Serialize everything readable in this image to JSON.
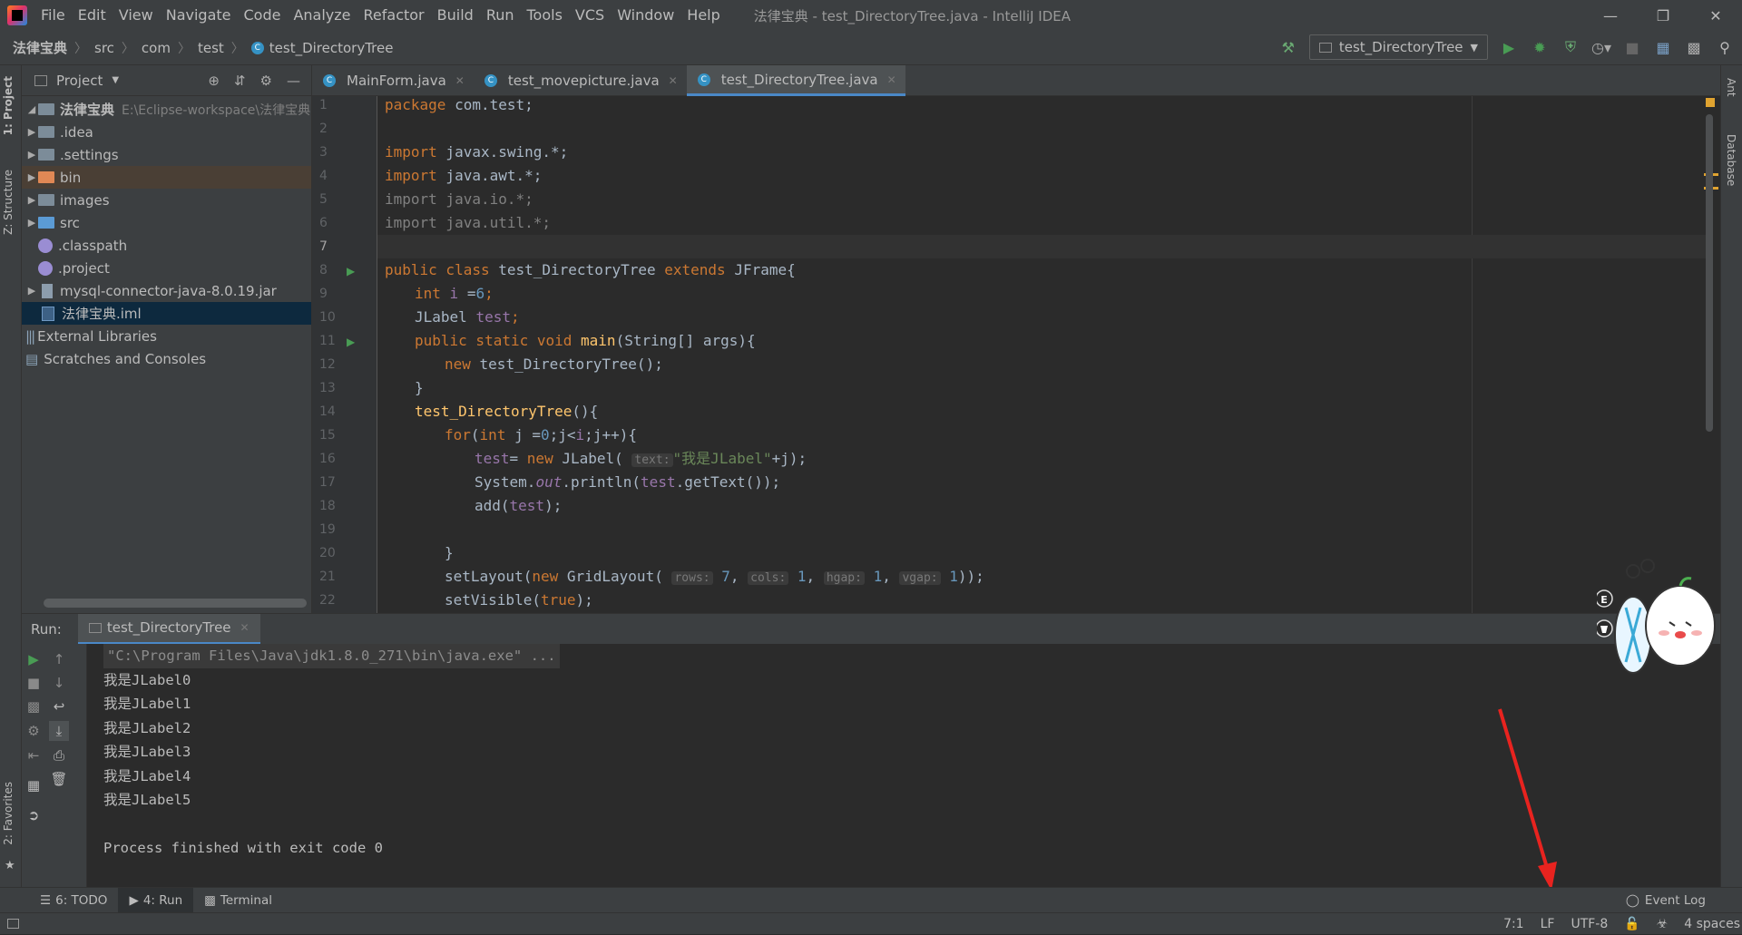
{
  "app": {
    "window_title": "法律宝典 - test_DirectoryTree.java - IntelliJ IDEA"
  },
  "menu": [
    "File",
    "Edit",
    "View",
    "Navigate",
    "Code",
    "Analyze",
    "Refactor",
    "Build",
    "Run",
    "Tools",
    "VCS",
    "Window",
    "Help"
  ],
  "breadcrumb": [
    "法律宝典",
    "src",
    "com",
    "test",
    "test_DirectoryTree"
  ],
  "run_config": "test_DirectoryTree",
  "left_stripe": {
    "project": "1: Project",
    "structure": "Z: Structure",
    "favorites": "2: Favorites"
  },
  "right_stripe": {
    "ant": "Ant",
    "database": "Database"
  },
  "project": {
    "header": "Project",
    "root_name": "法律宝典",
    "root_path": "E:\\Eclipse-workspace\\法律宝典",
    "items": [
      ".idea",
      ".settings",
      "bin",
      "images",
      "src",
      ".classpath",
      ".project",
      "mysql-connector-java-8.0.19.jar",
      "法律宝典.iml"
    ],
    "external": "External Libraries",
    "scratches": "Scratches and Consoles"
  },
  "tabs": [
    "MainForm.java",
    "test_movepicture.java",
    "test_DirectoryTree.java"
  ],
  "line_numbers": [
    "1",
    "2",
    "3",
    "4",
    "5",
    "6",
    "7",
    "8",
    "9",
    "10",
    "11",
    "12",
    "13",
    "14",
    "15",
    "16",
    "17",
    "18",
    "19",
    "20",
    "21",
    "22"
  ],
  "code": {
    "l1_kw": "package",
    "l1_rest": " com.test;",
    "l3_kw": "import",
    "l3_rest": " javax.swing.*;",
    "l4_kw": "import",
    "l4_rest": " java.awt.*;",
    "l5": "import java.io.*;",
    "l6": "import java.util.*;",
    "l8_kw": "public class",
    "l8_name": " test_DirectoryTree ",
    "l8_kw2": "extends",
    "l8_rest": " JFrame{",
    "l9_kw": "int",
    "l9_var": " i ",
    "l9_eq": "=",
    "l9_num": "6",
    "l9_end": ";",
    "l10_type": "JLabel ",
    "l10_var": "test",
    "l10_end": ";",
    "l11_kw": "public static void",
    "l11_fn": " main",
    "l11_rest": "(String[] args){",
    "l12_kw": "new",
    "l12_rest": " test_DirectoryTree();",
    "l13": "}",
    "l14_fn": "test_DirectoryTree",
    "l14_rest": "(){",
    "l15_kw": "for",
    "l15_a": "(",
    "l15_kw2": "int",
    "l15_b": " j =",
    "l15_num": "0",
    "l15_c": ";j<",
    "l15_i": "i",
    "l15_d": ";j++){",
    "l16_fld": "test",
    "l16_a": "= ",
    "l16_kw": "new",
    "l16_b": " JLabel( ",
    "l16_hint": "text:",
    "l16_str": "\"我是JLabel\"",
    "l16_c": "+j);",
    "l17_a": "System.",
    "l17_out": "out",
    "l17_b": ".println(",
    "l17_fld": "test",
    "l17_c": ".getText());",
    "l18_a": "add(",
    "l18_fld": "test",
    "l18_b": ");",
    "l20": "}",
    "l21_a": "setLayout(",
    "l21_kw": "new",
    "l21_b": " GridLayout( ",
    "l21_h1": "rows:",
    "l21_n1": " 7",
    "l21_c1": ", ",
    "l21_h2": "cols:",
    "l21_n2": " 1",
    "l21_c2": ", ",
    "l21_h3": "hgap:",
    "l21_n3": " 1",
    "l21_c3": ", ",
    "l21_h4": "vgap:",
    "l21_n4": " 1",
    "l21_end": "));",
    "l22_a": "setVisible(",
    "l22_kw": "true",
    "l22_b": ");"
  },
  "run": {
    "label": "Run:",
    "tab": "test_DirectoryTree",
    "console": {
      "cmd": "\"C:\\Program Files\\Java\\jdk1.8.0_271\\bin\\java.exe\" ...",
      "lines": [
        "我是JLabel0",
        "我是JLabel1",
        "我是JLabel2",
        "我是JLabel3",
        "我是JLabel4",
        "我是JLabel5"
      ],
      "blank": "",
      "finish": "Process finished with exit code 0"
    }
  },
  "bottom_bar": {
    "todo": "6: TODO",
    "run": "4: Run",
    "terminal": "Terminal",
    "event_log": "Event Log"
  },
  "status": {
    "position": "7:1",
    "line_sep": "LF",
    "encoding": "UTF-8",
    "indent": "4 spaces"
  },
  "colors": {
    "keyword": "#cc7832",
    "string": "#6a8759",
    "number": "#6897bb",
    "field": "#9876aa",
    "function": "#ffc66d",
    "accent": "#4a88c7"
  }
}
